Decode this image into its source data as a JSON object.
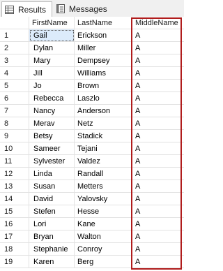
{
  "tabs": {
    "results_label": "Results",
    "messages_label": "Messages"
  },
  "columns": {
    "row_num": "",
    "first": "FirstName",
    "last": "LastName",
    "middle": "MiddleName"
  },
  "rows": [
    {
      "n": "1",
      "first": "Gail",
      "last": "Erickson",
      "middle": "A"
    },
    {
      "n": "2",
      "first": "Dylan",
      "last": "Miller",
      "middle": "A"
    },
    {
      "n": "3",
      "first": "Mary",
      "last": "Dempsey",
      "middle": "A"
    },
    {
      "n": "4",
      "first": "Jill",
      "last": "Williams",
      "middle": "A"
    },
    {
      "n": "5",
      "first": "Jo",
      "last": "Brown",
      "middle": "A"
    },
    {
      "n": "6",
      "first": "Rebecca",
      "last": "Laszlo",
      "middle": "A"
    },
    {
      "n": "7",
      "first": "Nancy",
      "last": "Anderson",
      "middle": "A"
    },
    {
      "n": "8",
      "first": "Merav",
      "last": "Netz",
      "middle": "A"
    },
    {
      "n": "9",
      "first": "Betsy",
      "last": "Stadick",
      "middle": "A"
    },
    {
      "n": "10",
      "first": "Sameer",
      "last": "Tejani",
      "middle": "A"
    },
    {
      "n": "11",
      "first": "Sylvester",
      "last": "Valdez",
      "middle": "A"
    },
    {
      "n": "12",
      "first": "Linda",
      "last": "Randall",
      "middle": "A"
    },
    {
      "n": "13",
      "first": "Susan",
      "last": "Metters",
      "middle": "A"
    },
    {
      "n": "14",
      "first": "David",
      "last": "Yalovsky",
      "middle": "A"
    },
    {
      "n": "15",
      "first": "Stefen",
      "last": "Hesse",
      "middle": "A"
    },
    {
      "n": "16",
      "first": "Lori",
      "last": "Kane",
      "middle": "A"
    },
    {
      "n": "17",
      "first": "Bryan",
      "last": "Walton",
      "middle": "A"
    },
    {
      "n": "18",
      "first": "Stephanie",
      "last": "Conroy",
      "middle": "A"
    },
    {
      "n": "19",
      "first": "Karen",
      "last": "Berg",
      "middle": "A"
    }
  ],
  "highlight_color": "#b01c1c",
  "selection_color": "#dcebfb"
}
